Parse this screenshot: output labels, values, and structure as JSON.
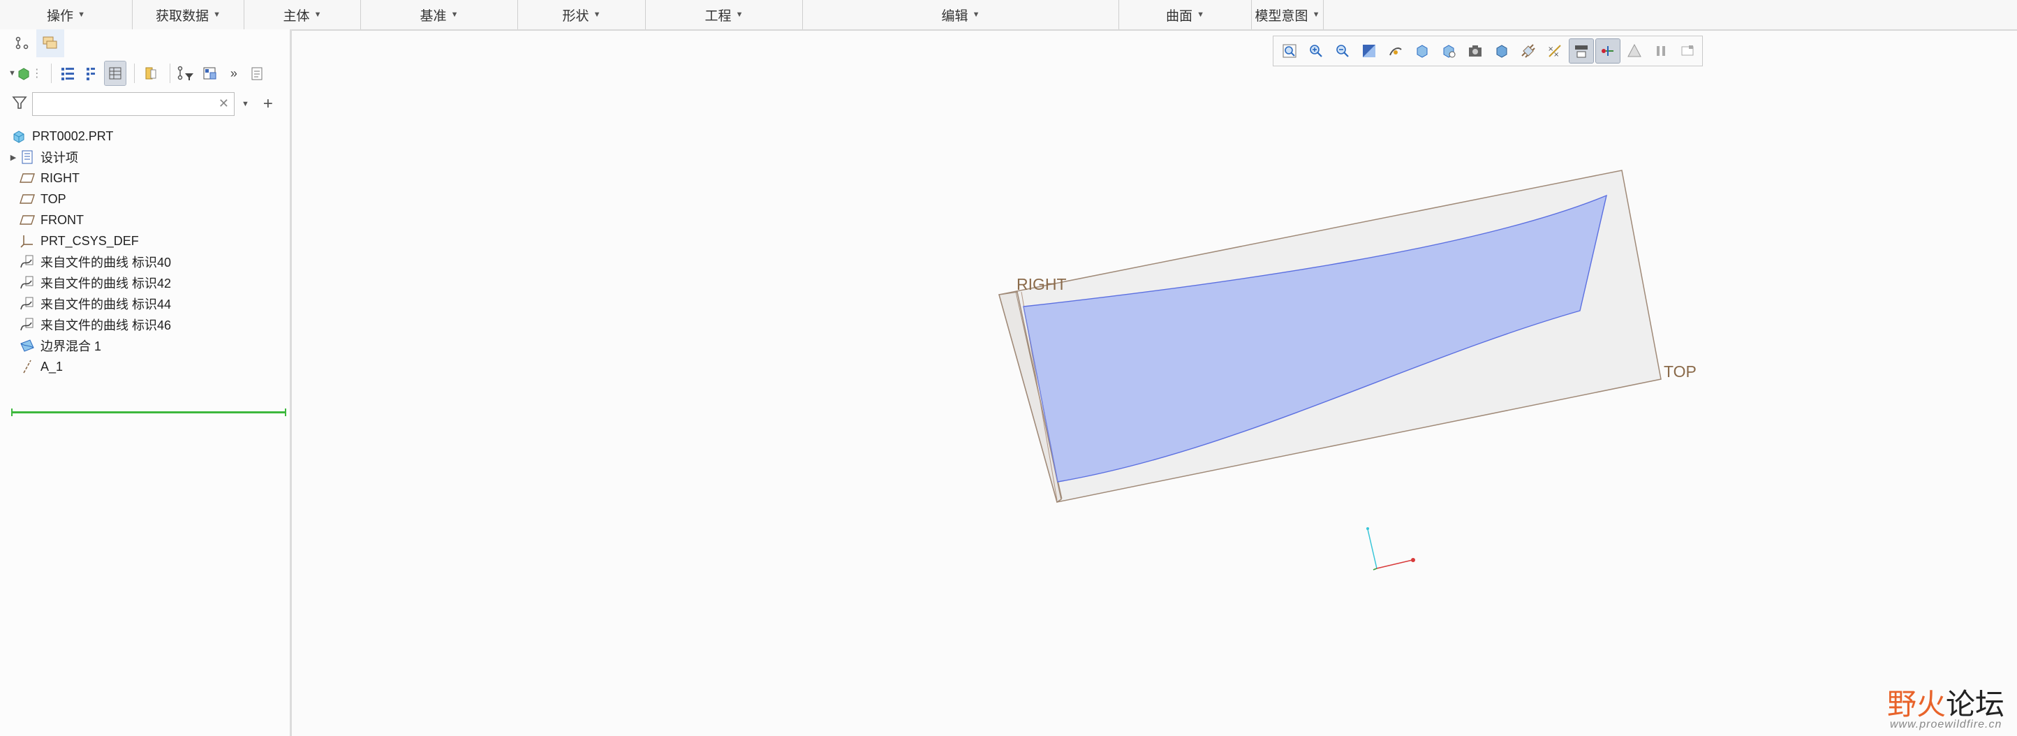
{
  "ribbon": {
    "groups": [
      {
        "label": "操作"
      },
      {
        "label": "获取数据"
      },
      {
        "label": "主体"
      },
      {
        "label": "基准"
      },
      {
        "label": "形状"
      },
      {
        "label": "工程"
      },
      {
        "label": "编辑"
      },
      {
        "label": "曲面"
      },
      {
        "label": "模型意图"
      }
    ]
  },
  "model_tree": {
    "search_value": "",
    "root": "PRT0002.PRT",
    "items": [
      {
        "label": "设计项",
        "icon": "design-items-icon",
        "expandable": true
      },
      {
        "label": "RIGHT",
        "icon": "datum-plane-icon"
      },
      {
        "label": "TOP",
        "icon": "datum-plane-icon"
      },
      {
        "label": "FRONT",
        "icon": "datum-plane-icon"
      },
      {
        "label": "PRT_CSYS_DEF",
        "icon": "coordinate-system-icon"
      },
      {
        "label": "来自文件的曲线 标识40",
        "icon": "curve-from-file-icon"
      },
      {
        "label": "来自文件的曲线 标识42",
        "icon": "curve-from-file-icon"
      },
      {
        "label": "来自文件的曲线 标识44",
        "icon": "curve-from-file-icon"
      },
      {
        "label": "来自文件的曲线 标识46",
        "icon": "curve-from-file-icon"
      },
      {
        "label": "边界混合 1",
        "icon": "boundary-blend-icon"
      },
      {
        "label": "A_1",
        "icon": "datum-axis-icon"
      }
    ]
  },
  "viewport": {
    "plane_labels": {
      "right": "RIGHT",
      "top": "TOP"
    },
    "surface_color": "#b6c3f3",
    "surface_edge_color": "#5b6fe0",
    "plane_edge_color": "#a08a78"
  },
  "watermark": {
    "brand_part1": "野火",
    "brand_part2": "论坛",
    "url": "www.proewildfire.cn"
  }
}
